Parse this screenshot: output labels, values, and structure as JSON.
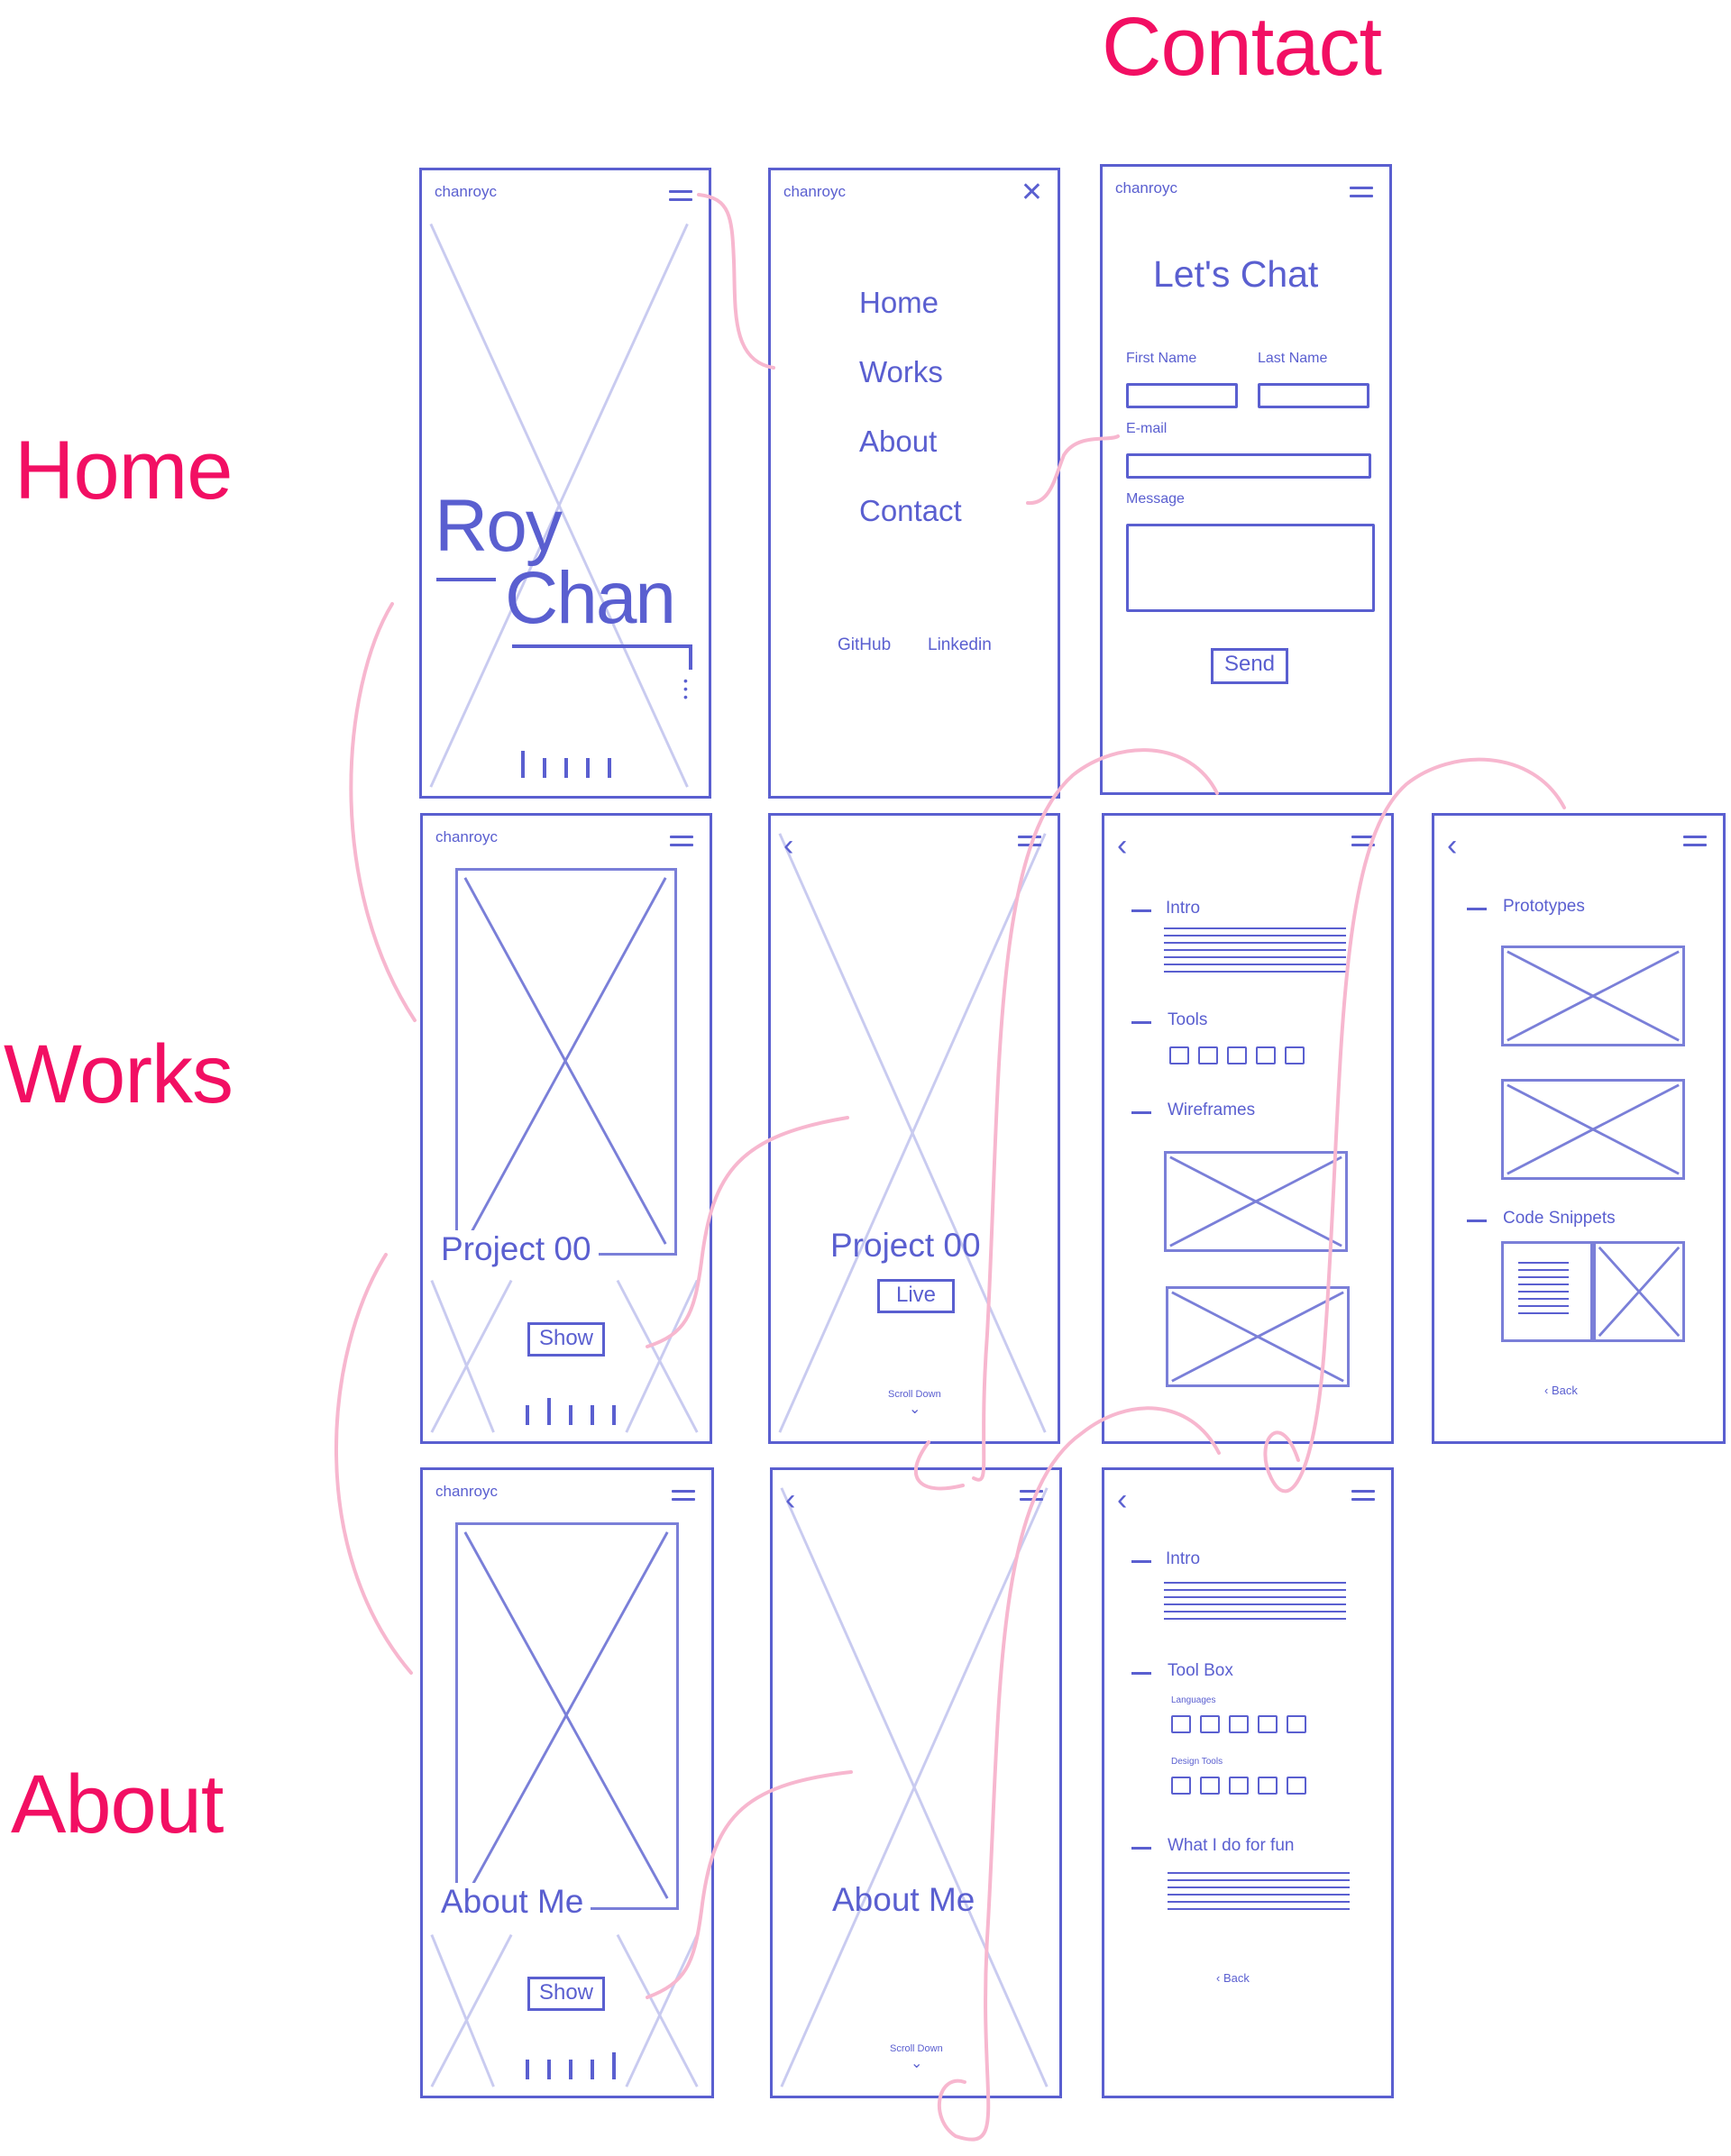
{
  "labels": {
    "home": "Home",
    "works": "Works",
    "about": "About",
    "contact": "Contact"
  },
  "brand": "chanroyc",
  "home": {
    "first_name": "Roy",
    "last_name": "Chan"
  },
  "menu": {
    "items": [
      "Home",
      "Works",
      "About",
      "Contact"
    ],
    "github": "GitHub",
    "linkedin": "Linkedin"
  },
  "contact_form": {
    "title": "Let's Chat",
    "first_name": "First Name",
    "last_name": "Last Name",
    "email": "E-mail",
    "message": "Message",
    "send": "Send"
  },
  "works_list": {
    "project": "Project 00",
    "show": "Show"
  },
  "works_detail": {
    "project": "Project 00",
    "live": "Live",
    "scroll": "Scroll Down"
  },
  "works_page": {
    "intro": "Intro",
    "tools": "Tools",
    "wireframes": "Wireframes"
  },
  "works_page2": {
    "prototypes": "Prototypes",
    "code": "Code Snippets",
    "back": "Back"
  },
  "about_list": {
    "title": "About Me",
    "show": "Show"
  },
  "about_detail": {
    "title": "About Me",
    "scroll": "Scroll Down"
  },
  "about_page": {
    "intro": "Intro",
    "toolbox": "Tool Box",
    "languages": "Languages",
    "design_tools": "Design Tools",
    "fun": "What I do for fun",
    "back": "Back"
  },
  "colors": {
    "wire": "#5a5fd0",
    "accent": "#f20f63",
    "flow": "#f7b7cf"
  }
}
